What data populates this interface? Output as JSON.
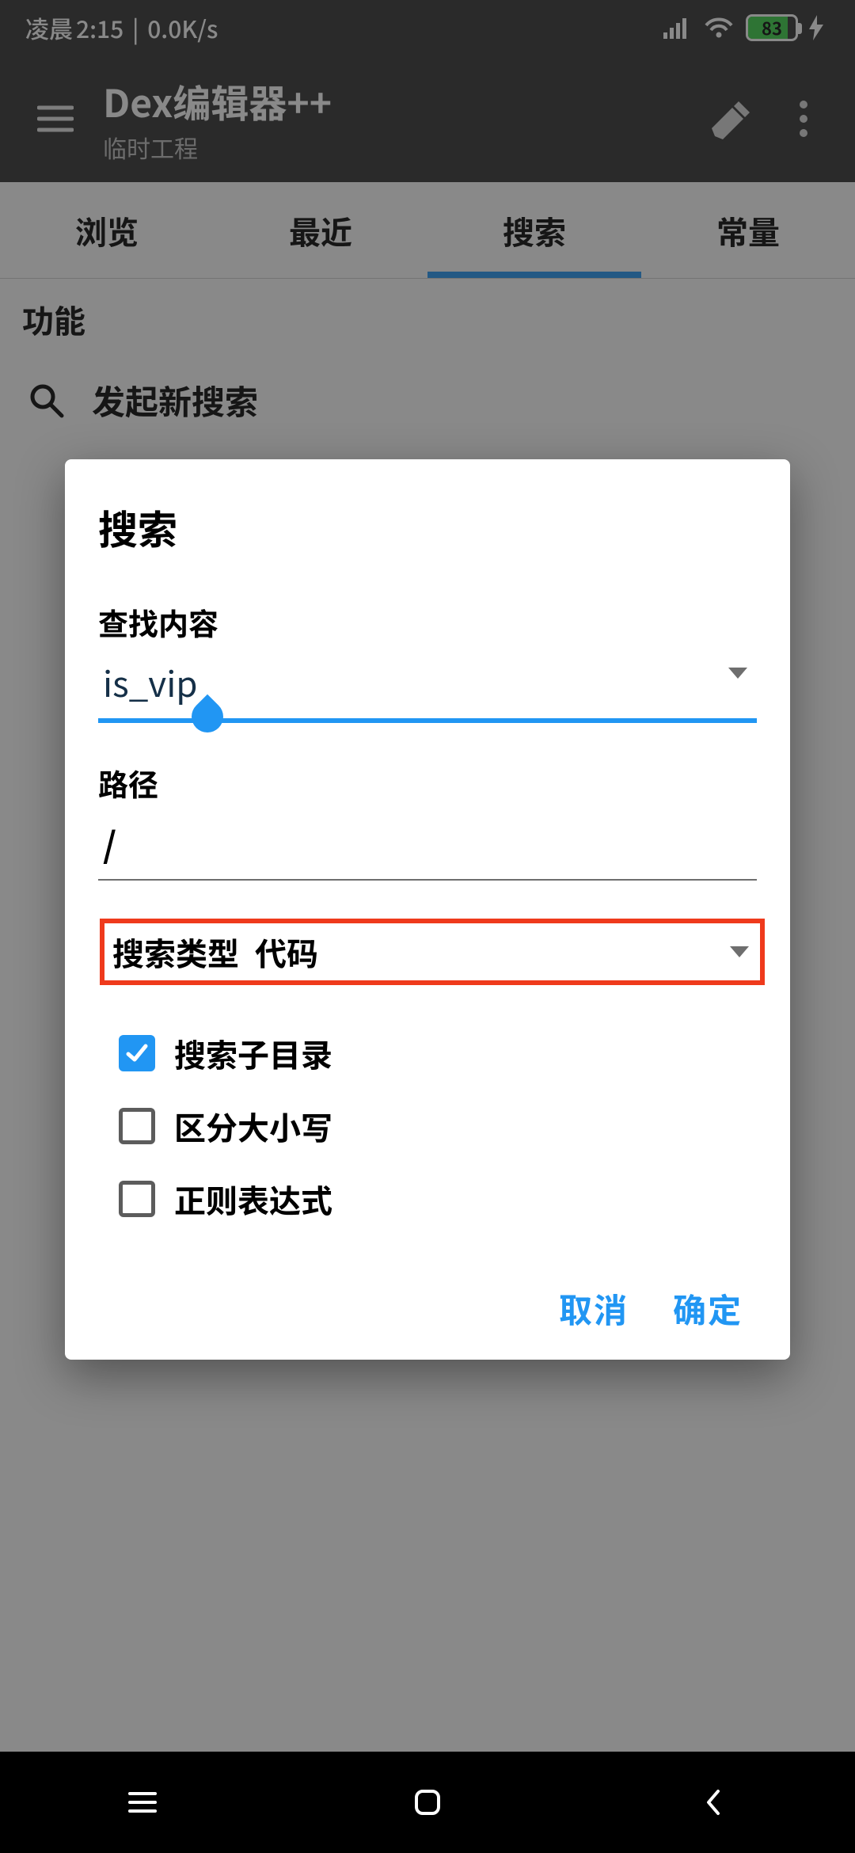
{
  "status": {
    "time_prefix": "凌晨",
    "time": "2:15",
    "net_speed": "0.0K/s",
    "battery_pct": "83"
  },
  "appbar": {
    "title": "Dex编辑器++",
    "subtitle": "临时工程"
  },
  "tabs": [
    {
      "label": "浏览",
      "active": false
    },
    {
      "label": "最近",
      "active": false
    },
    {
      "label": "搜索",
      "active": true
    },
    {
      "label": "常量",
      "active": false
    }
  ],
  "section_label": "功能",
  "list": {
    "new_search": "发起新搜索"
  },
  "dialog": {
    "title": "搜索",
    "find_label": "查找内容",
    "find_value": "is_vip",
    "path_label": "路径",
    "path_value": "/",
    "type_label": "搜索类型",
    "type_value": "代码",
    "checks": [
      {
        "label": "搜索子目录",
        "checked": true
      },
      {
        "label": "区分大小写",
        "checked": false
      },
      {
        "label": "正则表达式",
        "checked": false
      }
    ],
    "cancel": "取消",
    "ok": "确定"
  }
}
